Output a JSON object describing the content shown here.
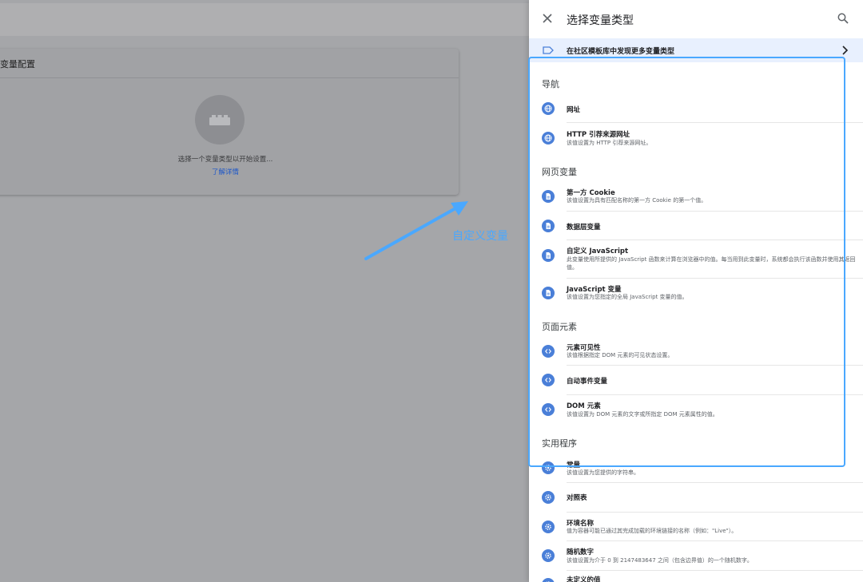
{
  "workspace": {
    "card_title": "变量配置",
    "hint": "选择一个变量类型以开始设置...",
    "link": "了解详情"
  },
  "annotation": {
    "label": "自定义变量",
    "color": "#4aa8ff"
  },
  "drawer": {
    "title": "选择变量类型",
    "community_link": "在社区模板库中发现更多变量类型",
    "sections": [
      {
        "title": "导航",
        "items": [
          {
            "name": "网址",
            "desc": ""
          },
          {
            "name": "HTTP 引荐来源网址",
            "desc": "该值设置为 HTTP 引荐来源网址。"
          }
        ]
      },
      {
        "title": "网页变量",
        "items": [
          {
            "name": "第一方 Cookie",
            "desc": "该值设置为具有匹配名称的第一方 Cookie 的第一个值。"
          },
          {
            "name": "数据层变量",
            "desc": ""
          },
          {
            "name": "自定义 JavaScript",
            "desc": "此变量使用所提供的 JavaScript 函数来计算在浏览器中的值。每当用到此变量时，系统都会执行该函数并使用其返回值。"
          },
          {
            "name": "JavaScript 变量",
            "desc": "该值设置为您指定的全局 JavaScript 变量的值。"
          }
        ]
      },
      {
        "title": "页面元素",
        "items": [
          {
            "name": "元素可见性",
            "desc": "该值根据指定 DOM 元素的可见状态设置。"
          },
          {
            "name": "自动事件变量",
            "desc": ""
          },
          {
            "name": "DOM 元素",
            "desc": "该值设置为 DOM 元素的文字或所指定 DOM 元素属性的值。"
          }
        ]
      },
      {
        "title": "实用程序",
        "items": [
          {
            "name": "常量",
            "desc": "该值设置为您提供的字符串。"
          },
          {
            "name": "对照表",
            "desc": ""
          },
          {
            "name": "环境名称",
            "desc": "值为容器可能已通过其完成加载的环境链接的名称（例如：\"Live\"）。"
          },
          {
            "name": "随机数字",
            "desc": "该值设置为介于 0 到 2147483647 之间（包含边界值）的一个随机数字。"
          },
          {
            "name": "未定义的值",
            "desc": ""
          }
        ]
      }
    ]
  },
  "colors": {
    "accent": "#4a7fd8",
    "highlight_bg": "#e8f0fe"
  }
}
